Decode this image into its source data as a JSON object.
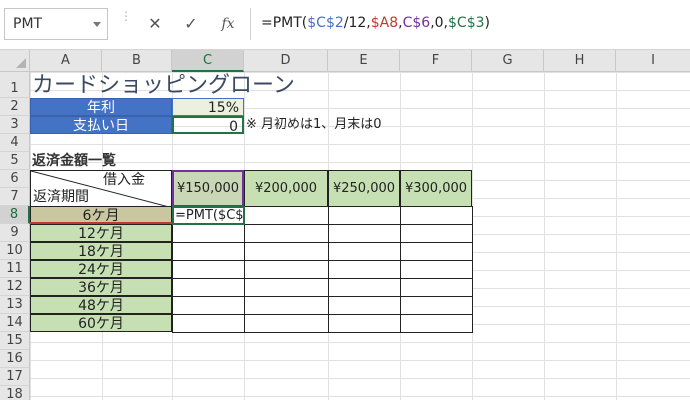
{
  "formula_bar": {
    "name_box": "PMT",
    "cancel_icon": "cancel-icon",
    "enter_icon": "check-icon",
    "fx_label": "fx",
    "formula_parts": [
      {
        "text": "=PMT(",
        "color": "#222222"
      },
      {
        "text": "$C$2",
        "color": "#4472c4"
      },
      {
        "text": "/12,",
        "color": "#222222"
      },
      {
        "text": "$A8",
        "color": "#c0392b"
      },
      {
        "text": ",",
        "color": "#222222"
      },
      {
        "text": "C$6",
        "color": "#7030a0"
      },
      {
        "text": ",0,",
        "color": "#222222"
      },
      {
        "text": "$C$3",
        "color": "#217346"
      },
      {
        "text": ")",
        "color": "#222222"
      }
    ]
  },
  "columns": [
    "A",
    "B",
    "C",
    "D",
    "E",
    "F",
    "G",
    "H",
    "I"
  ],
  "selected_column": "C",
  "rows": [
    "1",
    "2",
    "3",
    "4",
    "5",
    "6",
    "7",
    "8",
    "9",
    "10",
    "11",
    "12",
    "13",
    "14",
    "15",
    "16",
    "17",
    "18"
  ],
  "selected_row": "8",
  "sheet": {
    "title": "カードショッピングローン",
    "rate_label": "年利",
    "rate_value": "15%",
    "payday_label": "支払い日",
    "payday_value": "0",
    "payday_note": "※ 月初めは1、月末は0",
    "section_title": "返済金額一覧",
    "corner_top": "借入金",
    "corner_bottom": "返済期間",
    "amounts": [
      "¥150,000",
      "¥200,000",
      "¥250,000",
      "¥300,000"
    ],
    "periods": [
      "6ケ月",
      "12ケ月",
      "18ケ月",
      "24ケ月",
      "36ケ月",
      "48ケ月",
      "60ケ月"
    ],
    "editing_cell_text": "=PMT($C$"
  },
  "colors": {
    "header_blue": "#4472c4",
    "label_green": "#c6e0b4",
    "selection_green": "#217346"
  }
}
